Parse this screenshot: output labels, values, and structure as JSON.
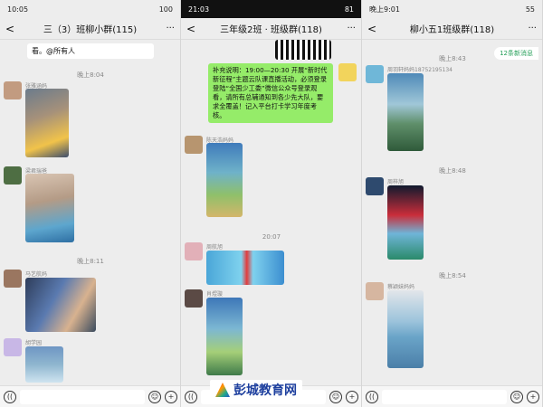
{
  "panels": [
    {
      "status": {
        "time": "10:05",
        "battery": "100"
      },
      "title": "三（3）班柳小群(115)",
      "top_bubble": "看。@所有人",
      "times": [
        "晚上8:04",
        "晚上8:11"
      ],
      "names": [
        "张雅涵妈",
        "梁君瑞爸",
        "马艺航妈",
        "胡学园"
      ]
    },
    {
      "status": {
        "time": "21:03",
        "battery": "81"
      },
      "title": "三年级2班 · 班级群(118)",
      "notice_text": "补充说明：19:00—20:30 开展“新时代 新征程”主题云队课直播活动，必须登录登陆“全国少工委”微信公众号登录观看，请所有总辅通知到各少先大队，要求全覆盖！记入平台打卡学习年度考核。",
      "times": [
        "20:07"
      ],
      "names": [
        "陈天浩妈妈",
        "周航旭",
        "肖煜璇"
      ]
    },
    {
      "status": {
        "time": "晚上9:01",
        "battery": "55"
      },
      "title": "柳小五1班级群(118)",
      "new_msgs": "12条新消息",
      "times": [
        "晚上8:43",
        "晚上8:48",
        "晚上8:54"
      ],
      "names": [
        "周羽轩妈妈18752195134",
        "周梓旭",
        "蔡颖妹妈妈"
      ]
    }
  ],
  "logo_text": "彭城教育网",
  "icons": {
    "back": "<",
    "more": "···",
    "voice": "((",
    "emoji": "☺",
    "plus": "+"
  }
}
